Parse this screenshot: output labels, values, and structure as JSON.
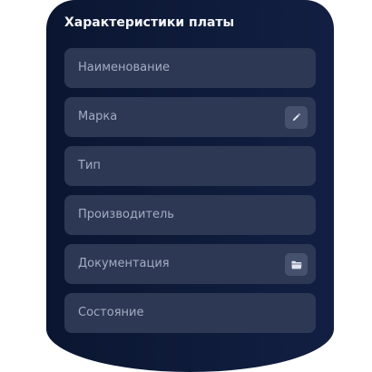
{
  "panel": {
    "title": "Характеристики платы",
    "fields": [
      {
        "label": "Наименование",
        "action_icon": null
      },
      {
        "label": "Марка",
        "action_icon": "pencil-icon"
      },
      {
        "label": "Тип",
        "action_icon": null
      },
      {
        "label": "Производитель",
        "action_icon": null
      },
      {
        "label": "Документация",
        "action_icon": "folder-icon"
      },
      {
        "label": "Состояние",
        "action_icon": null
      }
    ]
  },
  "colors": {
    "panel_background": "#0e1a3a",
    "field_background": "#2d3855",
    "field_text": "#a3adc2",
    "button_background": "#46516e",
    "title_text": "#f4f6fb"
  }
}
